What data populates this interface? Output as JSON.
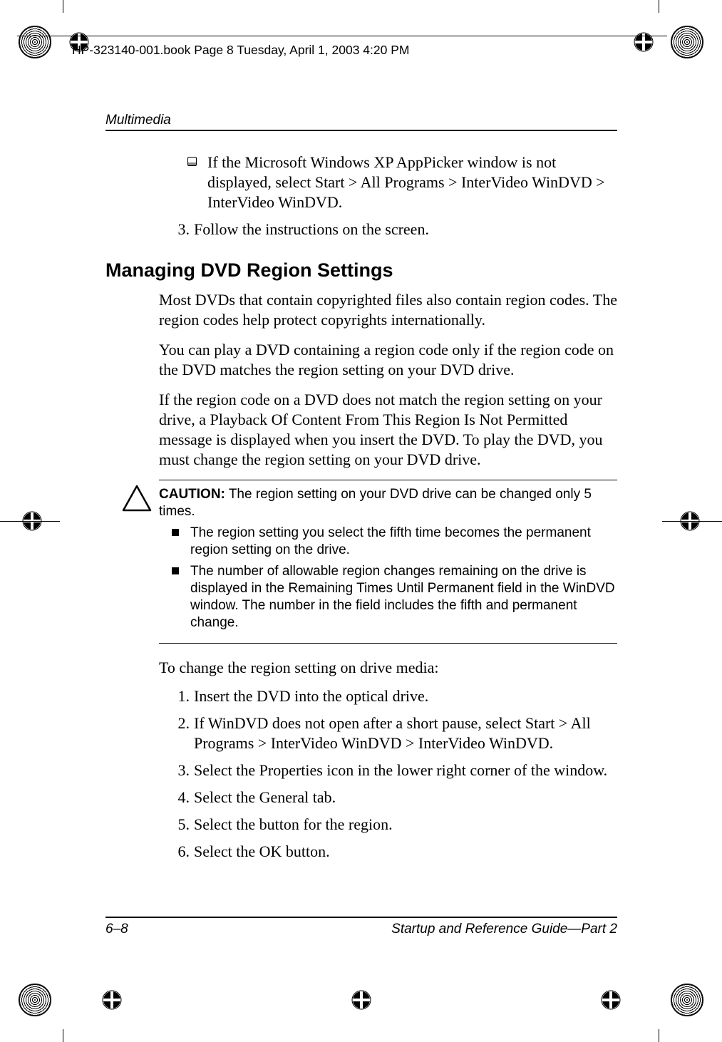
{
  "meta_header": "HP-323140-001.book  Page 8  Tuesday, April 1, 2003  4:20 PM",
  "running_head": "Multimedia",
  "pre_bullet": "If the Microsoft Windows XP AppPicker window is not displayed, select Start > All Programs > InterVideo WinDVD > InterVideo WinDVD.",
  "pre_step_num": "3.",
  "pre_step_text": "Follow the instructions on the screen.",
  "heading": "Managing DVD Region Settings",
  "para1": "Most DVDs that contain copyrighted files also contain region codes. The region codes help protect copyrights internationally.",
  "para2": "You can play a DVD containing a region code only if the region code on the DVD matches the region setting on your DVD drive.",
  "para3": "If the region code on a DVD does not match the region setting on your drive, a Playback Of Content From This Region Is Not Permitted message is displayed when you insert the DVD. To play the DVD, you must change the region setting on your DVD drive.",
  "caution_label": "CAUTION:",
  "caution_lead": " The region setting on your DVD drive can be changed only 5 times.",
  "caution_b1": "The region setting you select the fifth time becomes the permanent region setting on the drive.",
  "caution_b2": "The number of allowable region changes remaining on the drive is displayed in the Remaining Times Until Permanent field in the WinDVD window. The number in the field includes the fifth and permanent change.",
  "change_lead": "To change the region setting on drive media:",
  "steps": {
    "n1": "1.",
    "t1": "Insert the DVD into the optical drive.",
    "n2": "2.",
    "t2": "If WinDVD does not open after a short pause, select Start > All Programs > InterVideo WinDVD > InterVideo WinDVD.",
    "n3": "3.",
    "t3": "Select the Properties icon in the lower right corner of the window.",
    "n4": "4.",
    "t4": "Select the General tab.",
    "n5": "5.",
    "t5": "Select the button for the region.",
    "n6": "6.",
    "t6": "Select the OK button."
  },
  "footer_left": "6–8",
  "footer_right": "Startup and Reference Guide—Part 2"
}
